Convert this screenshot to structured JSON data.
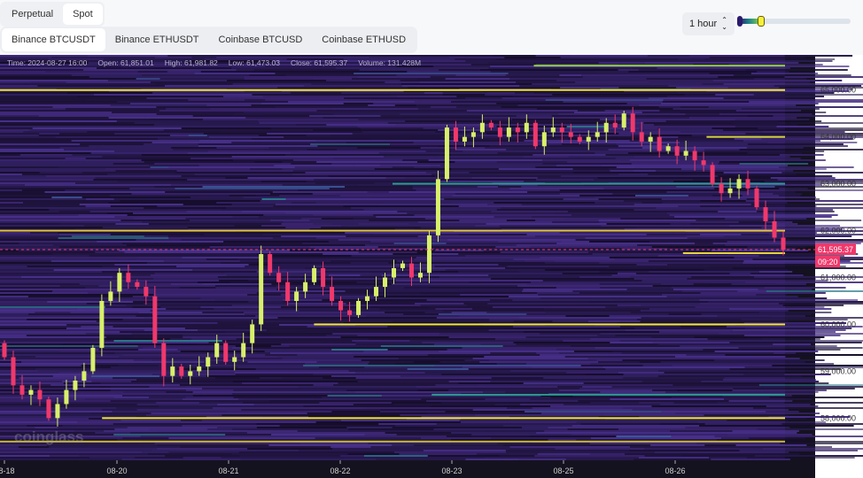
{
  "market_tabs": [
    {
      "label": "Perpetual",
      "active": false
    },
    {
      "label": "Spot",
      "active": true
    }
  ],
  "exchange_pills": [
    {
      "label": "Binance BTCUSDT",
      "active": true
    },
    {
      "label": "Binance ETHUSDT",
      "active": false
    },
    {
      "label": "Coinbase BTCUSD",
      "active": false
    },
    {
      "label": "Coinbase ETHUSD",
      "active": false
    }
  ],
  "interval": {
    "value": "1 hour",
    "icon": "updown-chevron-icon"
  },
  "color_range_slider": {
    "low": 0.0,
    "high": 0.2
  },
  "info": {
    "time": "Time: 2024-08-27 16:00",
    "open": "Open: 61,851.01",
    "high": "High: 61,981.82",
    "low": "Low: 61,473.03",
    "close": "Close: 61,595.37",
    "volume": "Volume: 131.428M"
  },
  "watermark": "coinglass",
  "chart_data": {
    "type": "heatmap",
    "overlay": "candlestick",
    "ylim": [
      57100,
      65750
    ],
    "y_ticks": [
      58000,
      59000,
      60000,
      61000,
      62000,
      63000,
      64000,
      65000
    ],
    "y_tick_labels": [
      "58,000.00",
      "59,000.00",
      "60,000.00",
      "61,000.00",
      "62,000.00",
      "63,000.00",
      "64,000.00",
      "65,000.00"
    ],
    "x_tick_labels": [
      "08-18",
      "08-20",
      "08-21",
      "08-22",
      "08-23",
      "08-25",
      "08-26"
    ],
    "current_price": {
      "label": "61,595.37",
      "value": 61595.37,
      "countdown": "09:20"
    },
    "last_candle": {
      "open": 61851.01,
      "high": 61981.82,
      "low": 61473.03,
      "close": 61595.37
    },
    "closes": [
      59300,
      58700,
      58500,
      58600,
      58400,
      58000,
      58300,
      58600,
      58800,
      59000,
      59500,
      60500,
      60700,
      61100,
      60900,
      60800,
      60600,
      59600,
      58900,
      59100,
      58900,
      59000,
      59100,
      59300,
      59600,
      59200,
      59300,
      59600,
      60000,
      61500,
      61100,
      60900,
      60500,
      60700,
      60900,
      61200,
      60800,
      60500,
      60300,
      60200,
      60500,
      60600,
      60800,
      61000,
      61200,
      61300,
      61000,
      61100,
      61900,
      63100,
      64200,
      63900,
      64000,
      64100,
      64300,
      64200,
      64000,
      64200,
      64100,
      64300,
      63800,
      64100,
      64200,
      64100,
      64000,
      63900,
      64000,
      64100,
      64300,
      64200,
      64500,
      64100,
      63900,
      64000,
      63700,
      63800,
      63600,
      63700,
      63500,
      63400,
      63000,
      62800,
      62900,
      63100,
      62900,
      62500,
      62200,
      61851.01,
      61595.37
    ],
    "liquidity_levels": [
      {
        "price": 65000,
        "color": "#f2e830",
        "from_fraction": 0.0
      },
      {
        "price": 65520,
        "color": "#8fd13f",
        "from_fraction": 0.68
      },
      {
        "price": 64000,
        "color": "#d4d43a",
        "from_fraction": 0.9
      },
      {
        "price": 62000,
        "color": "#e3c53a",
        "from_fraction": 0.0
      },
      {
        "price": 61520,
        "color": "#e8d83a",
        "from_fraction": 0.87
      },
      {
        "price": 60000,
        "color": "#f2e830",
        "from_fraction": 0.4
      },
      {
        "price": 58000,
        "color": "#f2e830",
        "from_fraction": 0.13
      },
      {
        "price": 57500,
        "color": "#c8b830",
        "from_fraction": 0.0
      },
      {
        "price": 58500,
        "color": "#2a9d8f",
        "from_fraction": 0.55
      },
      {
        "price": 63000,
        "color": "#2a9d8f",
        "from_fraction": 0.5
      }
    ],
    "colors": {
      "up": "#d8f06a",
      "down": "#f0386b",
      "background": "#2d1b55",
      "price_tag": "#f0386b"
    }
  }
}
